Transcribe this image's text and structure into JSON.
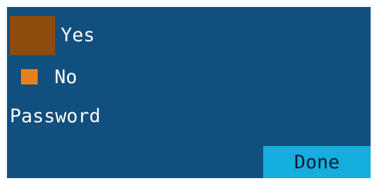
{
  "options": [
    {
      "label": "Yes",
      "swatch_color": "#8e4b0d"
    },
    {
      "label": "No",
      "swatch_color": "#e8801c"
    }
  ],
  "password_label": "Password",
  "done_button": {
    "label": "Done",
    "color": "#15aede"
  },
  "colors": {
    "background": "#104f7e",
    "text": "#ffffff"
  }
}
